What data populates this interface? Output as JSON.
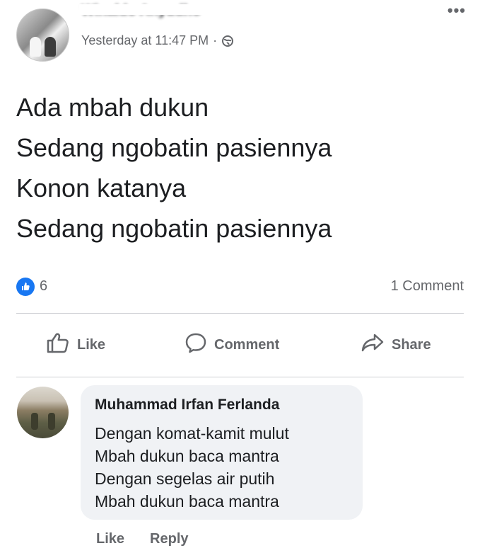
{
  "post": {
    "author": "Winaldo Anyudho",
    "timestamp": "Yesterday at 11:47 PM",
    "separator": "·",
    "privacy_icon": "globe-icon",
    "more_label": "•••",
    "lines": [
      "Ada mbah dukun",
      "Sedang ngobatin pasiennya",
      "Konon katanya",
      "Sedang ngobatin pasiennya"
    ]
  },
  "stats": {
    "reaction_icon": "like-badge-icon",
    "reaction_count": "6",
    "comment_count": "1 Comment"
  },
  "actions": {
    "like_label": "Like",
    "comment_label": "Comment",
    "share_label": "Share"
  },
  "comment": {
    "author": "Muhammad Irfan Ferlanda",
    "lines": [
      "Dengan komat-kamit mulut",
      "Mbah dukun baca mantra",
      "Dengan segelas air putih",
      "Mbah dukun baca mantra"
    ],
    "like_label": "Like",
    "reply_label": "Reply"
  },
  "colors": {
    "accent": "#1877f2",
    "secondary_text": "#65676b",
    "bubble": "#f0f2f5"
  }
}
